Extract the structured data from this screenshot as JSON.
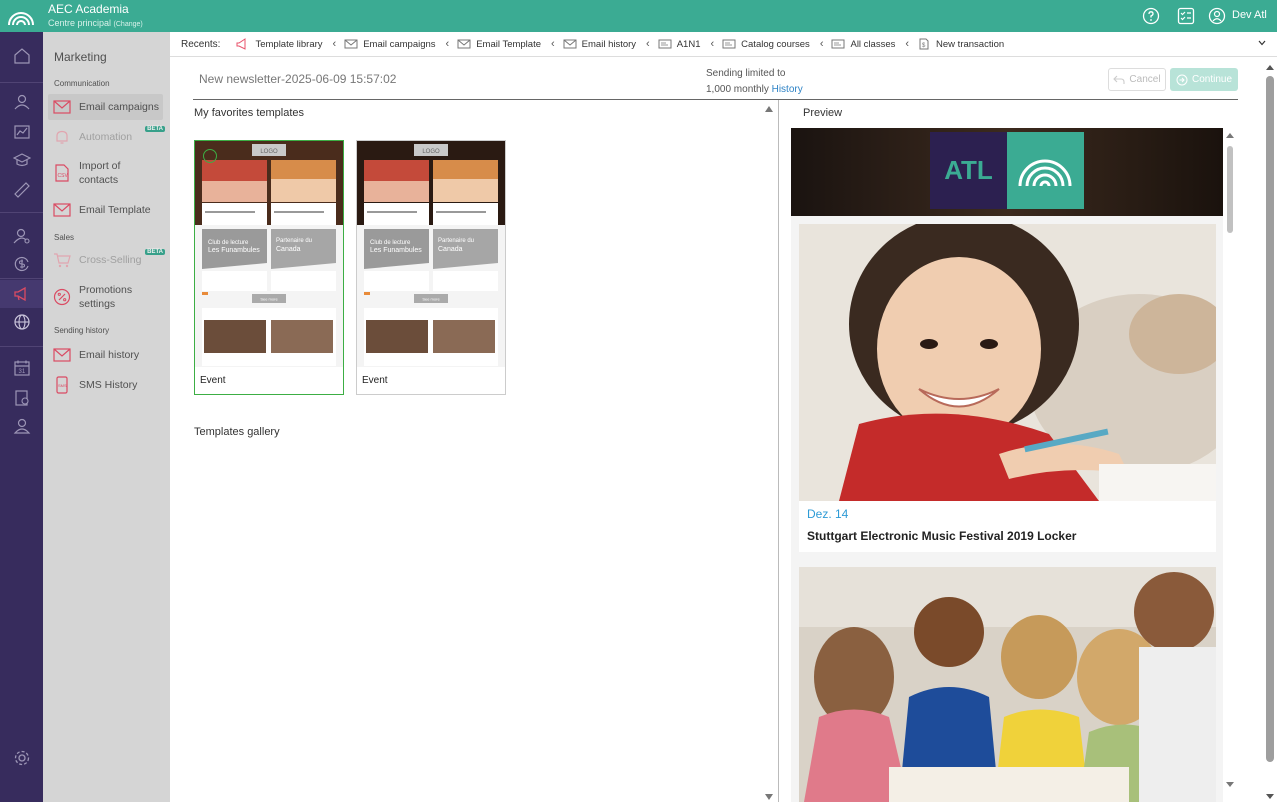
{
  "app": {
    "title": "AEC Academia",
    "centre": "Centre principal",
    "centre_change": "(Change)",
    "user": "Dev Atl"
  },
  "submenu": {
    "title": "Marketing",
    "sections": {
      "communication": "Communication",
      "sales": "Sales",
      "sending_history": "Sending history"
    },
    "items": [
      {
        "label": "Email campaigns",
        "icon": "envelope-icon",
        "active": true
      },
      {
        "label": "Automation",
        "icon": "bell-icon",
        "disabled": true,
        "badge": "BETA"
      },
      {
        "label": "Import of contacts",
        "icon": "csv-file-icon"
      },
      {
        "label": "Email Template",
        "icon": "envelope-icon"
      },
      {
        "label": "Cross-Selling",
        "icon": "cart-icon",
        "disabled": true,
        "badge": "BETA"
      },
      {
        "label": "Promotions settings",
        "icon": "percent-icon"
      },
      {
        "label": "Email history",
        "icon": "envelope-icon"
      },
      {
        "label": "SMS History",
        "icon": "sms-icon"
      }
    ]
  },
  "recents": {
    "label": "Recents:",
    "items": [
      {
        "label": "Template library",
        "icon": "megaphone-icon"
      },
      {
        "label": "Email campaigns",
        "icon": "envelope-icon"
      },
      {
        "label": "Email Template",
        "icon": "envelope-icon"
      },
      {
        "label": "Email history",
        "icon": "envelope-icon"
      },
      {
        "label": "A1N1",
        "icon": "board-icon"
      },
      {
        "label": "Catalog courses",
        "icon": "board-icon"
      },
      {
        "label": "All classes",
        "icon": "board-icon"
      },
      {
        "label": "New transaction",
        "icon": "dollar-doc-icon"
      }
    ]
  },
  "header": {
    "title": "New newsletter-2025-06-09 15:57:02",
    "limit_line1": "Sending limited to",
    "limit_line2": "1,000 monthly",
    "history_link": "History",
    "cancel": "Cancel",
    "continue": "Continue"
  },
  "templates": {
    "favorites_title": "My favorites templates",
    "gallery_title": "Templates gallery",
    "cards": [
      {
        "label": "Event",
        "selected": true
      },
      {
        "label": "Event",
        "selected": false
      }
    ],
    "thumb_text": {
      "logo": "LOGO",
      "club1": "Club de lecture",
      "club2": "Les Funambules",
      "partner1": "Partenaire du",
      "partner2": "Canada",
      "see_more": "See more"
    }
  },
  "preview": {
    "title": "Preview",
    "logo_text": "ATL",
    "date": "Dez. 14",
    "headline": "Stuttgart Electronic Music Festival 2019 Locker"
  },
  "colors": {
    "brand": "#3bab93",
    "rail": "#3b2f63",
    "link": "#2e83c6",
    "selected": "#3cae44"
  }
}
